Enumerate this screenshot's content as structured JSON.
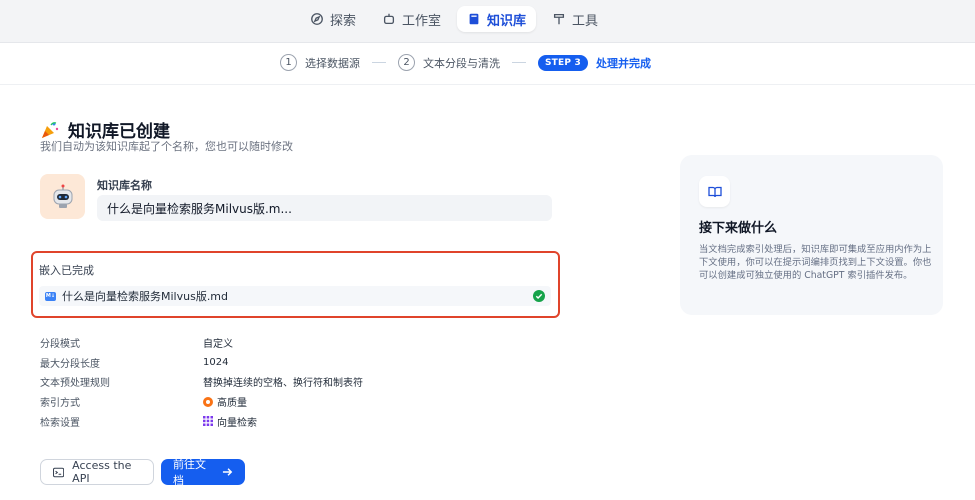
{
  "nav": {
    "items": [
      {
        "label": "探索",
        "icon": "compass-icon"
      },
      {
        "label": "工作室",
        "icon": "robot-icon"
      },
      {
        "label": "知识库",
        "icon": "book-icon",
        "active": true
      },
      {
        "label": "工具",
        "icon": "hammer-icon"
      }
    ]
  },
  "stepper": {
    "step1_num": "1",
    "step1_label": "选择数据源",
    "step2_num": "2",
    "step2_label": "文本分段与清洗",
    "step3_badge": "STEP 3",
    "step3_label": "处理并完成"
  },
  "header": {
    "title": "知识库已创建",
    "subtitle": "我们自动为该知识库起了个名称，您也可以随时修改"
  },
  "knowledge": {
    "name_label": "知识库名称",
    "name_value": "什么是向量检索服务Milvus版.m..."
  },
  "embedding": {
    "title": "嵌入已完成",
    "file_badge": "M↓",
    "file_name": "什么是向量检索服务Milvus版.md"
  },
  "settings": [
    {
      "key": "分段模式",
      "value": "自定义"
    },
    {
      "key": "最大分段长度",
      "value": "1024"
    },
    {
      "key": "文本预处理规则",
      "value": "替换掉连续的空格、换行符和制表符"
    },
    {
      "key": "索引方式",
      "value": "高质量",
      "icon": "quality-icon"
    },
    {
      "key": "检索设置",
      "value": "向量检索",
      "icon": "vector-icon"
    }
  ],
  "buttons": {
    "api_label": "Access the API",
    "doc_label": "前往文档"
  },
  "side_card": {
    "title": "接下来做什么",
    "text": "当文档完成索引处理后，知识库即可集成至应用内作为上下文使用，你可以在提示词编排页找到上下文设置。你也可以创建成可独立使用的 ChatGPT 索引插件发布。"
  },
  "colors": {
    "accent": "#155eef",
    "highlight_border": "#e0442b",
    "success": "#16a34a"
  }
}
